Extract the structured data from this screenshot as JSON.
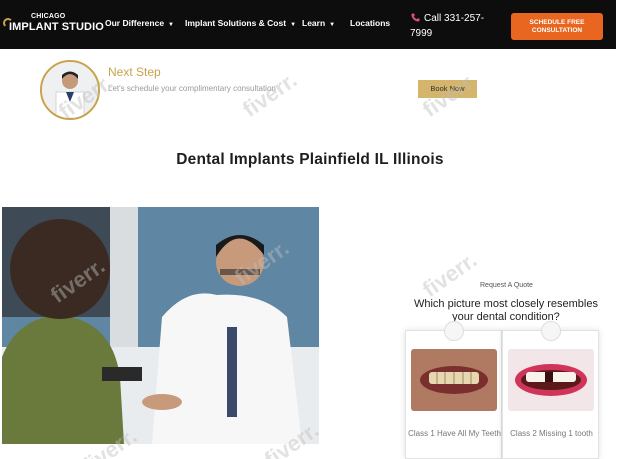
{
  "header": {
    "logo_top": "CHICAGO",
    "logo_main": "IMPLANT STUDIO",
    "nav": [
      {
        "label": "Our Difference",
        "dropdown": true
      },
      {
        "label": "Implant Solutions & Cost",
        "dropdown": true
      },
      {
        "label": "Learn",
        "dropdown": true
      },
      {
        "label": "Locations",
        "dropdown": false
      }
    ],
    "phone": "Call 331-257-7999",
    "cta_line1": "SCHEDULE FREE",
    "cta_line2": "CONSULTATION"
  },
  "next_step": {
    "title": "Next Step",
    "subtitle": "Let's schedule your complimentary consultation",
    "button": "Book Now"
  },
  "page_title": "Dental Implants Plainfield IL Illinois",
  "quote": {
    "label": "Request A Quote",
    "question": "Which picture most closely resembles your dental condition?",
    "cards": [
      {
        "label": "Class 1 Have All My Teeth"
      },
      {
        "label": "Class 2  Missing 1 tooth"
      }
    ]
  },
  "watermark": "fiverr.",
  "colors": {
    "header_bg": "#0d0d0d",
    "cta": "#e8661f",
    "gold": "#c9a24a",
    "book": "#d4b56b"
  }
}
